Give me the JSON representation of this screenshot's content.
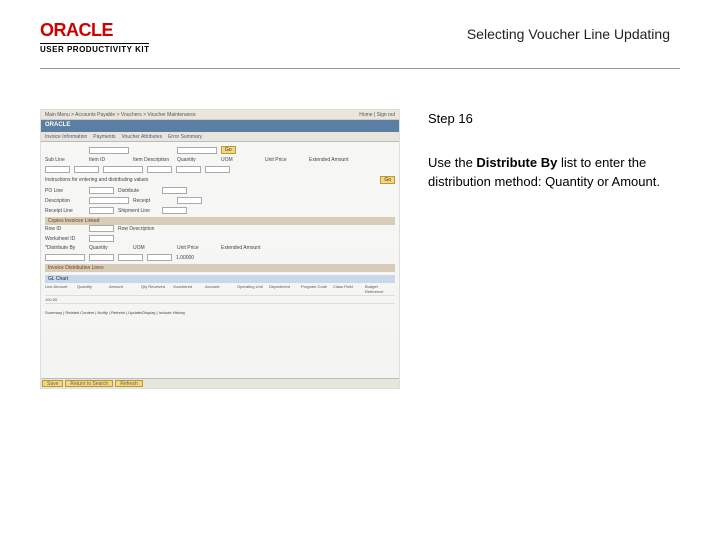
{
  "header": {
    "brand": "ORACLE",
    "subbrand": "USER PRODUCTIVITY KIT",
    "title": "Selecting Voucher Line Updating"
  },
  "instructions": {
    "step_label": "Step 16",
    "text_before": "Use the ",
    "text_bold": "Distribute By",
    "text_after": " list to enter the distribution method: Quantity or Amount."
  },
  "screenshot": {
    "breadcrumb_left": "Main Menu > Accounts Payable > Vouchers > Voucher Maintenance",
    "breadcrumb_right": "Home | Sign out",
    "brand": "ORACLE",
    "tabs": [
      "Invoice Information",
      "Payments",
      "Voucher Attributes",
      "Error Summary"
    ],
    "go_btn": "Go",
    "labels": {
      "sub_line": "Sub Line",
      "item_id": "Item ID",
      "item_desc": "Item Description",
      "quantity": "Quantity",
      "uom": "UOM",
      "unit_price": "Unit Price",
      "extended_amount": "Extended Amount",
      "instructions_line": "Instructions for entering and distributing values",
      "po_line": "PO Line",
      "distribute": "Distribute",
      "description": "Description",
      "receipt": "Receipt",
      "receipt_line": "Receipt Line",
      "shipment_line": "Shipment Line"
    },
    "section1": {
      "title": "Copies Invoices Linked",
      "row_id": "Row ID",
      "worksheet": "Worksheet ID",
      "row_description": "Row Description",
      "distribute_by": "*Distribute By",
      "quantity": "Quantity",
      "uom": "UOM",
      "unit_price": "Unit Price",
      "extended_amount": "Extended Amount",
      "val": "1.00000"
    },
    "section2": {
      "title": "Invoice Distribution Lines",
      "tab": "GL Chart",
      "cols": [
        "Line Amount",
        "Quantity",
        "Amount",
        "Qty Received",
        "Vouchered",
        "Account",
        "Operating Unit",
        "Department",
        "Program Code",
        "Class Field",
        "Budget Reference"
      ],
      "firstcol": "100.00"
    },
    "footer": {
      "save": "Save",
      "return": "Return to Search",
      "refresh": "Refresh"
    },
    "bullet_note": "Summary | Related Content | Notify | Refresh | Update/Display | Include History"
  }
}
